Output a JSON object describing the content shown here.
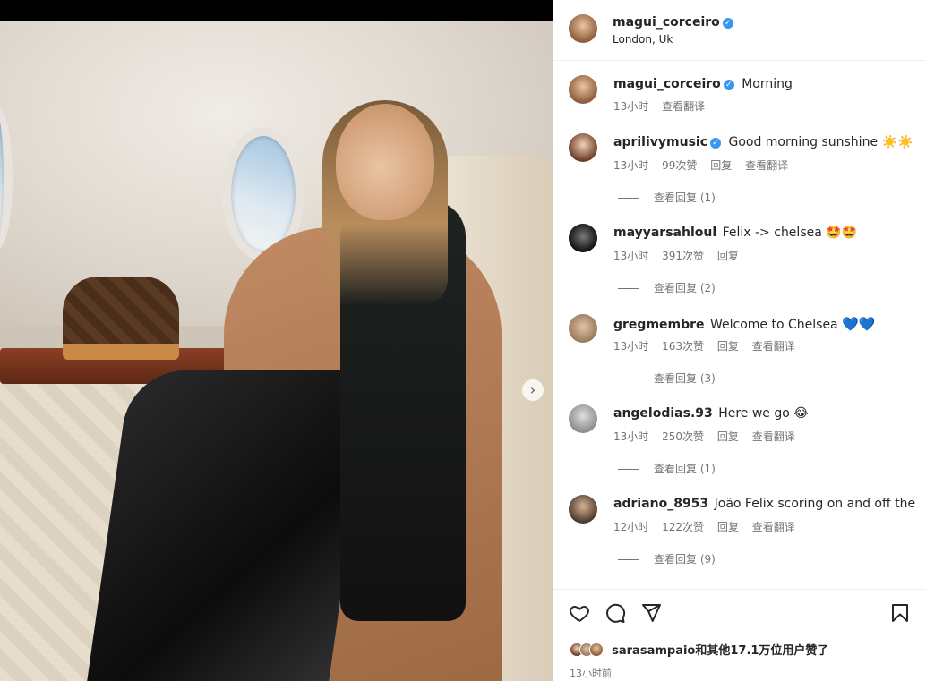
{
  "post": {
    "author": "magui_corceiro",
    "location": "London, Uk",
    "caption": {
      "username": "magui_corceiro",
      "text": "Morning",
      "time": "13小时",
      "translate": "查看翻译"
    }
  },
  "comments": [
    {
      "username": "aprilivymusic",
      "verified": true,
      "text": "Good morning sunshine",
      "emoji": "☀️☀️",
      "time": "13小时",
      "likes": "99次赞",
      "reply": "回复",
      "translate": "查看翻译",
      "view_replies": "查看回复 (1)"
    },
    {
      "username": "mayyarsahloul",
      "verified": false,
      "text": "Felix -> chelsea",
      "emoji": "🤩🤩",
      "time": "13小时",
      "likes": "391次赞",
      "reply": "回复",
      "translate": "",
      "view_replies": "查看回复 (2)"
    },
    {
      "username": "gregmembre",
      "verified": false,
      "text": "Welcome to Chelsea",
      "emoji": "💙💙",
      "time": "13小时",
      "likes": "163次赞",
      "reply": "回复",
      "translate": "查看翻译",
      "view_replies": "查看回复 (3)"
    },
    {
      "username": "angelodias.93",
      "verified": false,
      "text": "Here we go",
      "emoji": "😂",
      "time": "13小时",
      "likes": "250次赞",
      "reply": "回复",
      "translate": "查看翻译",
      "view_replies": "查看回复 (1)"
    },
    {
      "username": "adriano_8953",
      "verified": false,
      "text": "João Felix scoring on and off the pitch",
      "emoji": "",
      "time": "12小时",
      "likes": "122次赞",
      "reply": "回复",
      "translate": "查看翻译",
      "view_replies": "查看回复 (9)"
    }
  ],
  "footer": {
    "likes_user": "sarasampaio",
    "likes_rest": "和其他17.1万位用户赞了",
    "timestamp": "13小时前"
  },
  "icons": {
    "like": "heart-icon",
    "comment": "comment-icon",
    "share": "send-icon",
    "save": "bookmark-icon",
    "next": "chevron-right-icon"
  },
  "colors": {
    "verified": "#3897f0",
    "meta_text": "#737373",
    "text": "#262626"
  }
}
